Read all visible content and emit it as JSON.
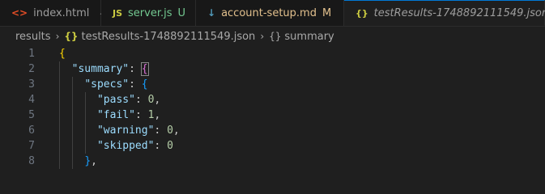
{
  "tabs": [
    {
      "icon": "html-file-icon",
      "icon_glyph": "<>",
      "icon_color": "#e44d26",
      "label": "index.html",
      "trail": "pin",
      "label_color": "#9d9d9d"
    },
    {
      "icon": "js-file-icon",
      "icon_glyph": "JS",
      "icon_color": "#cbcb41",
      "label": "server.js",
      "status": "U",
      "label_color": "#73c991"
    },
    {
      "icon": "markdown-file-icon",
      "icon_glyph": "↓",
      "icon_color": "#519aba",
      "label": "account-setup.md",
      "status": "M",
      "label_color": "#e2c08d"
    },
    {
      "icon": "json-file-icon",
      "icon_glyph": "{}",
      "icon_color": "#cbcb41",
      "label": "testResults-1748892111549.json",
      "trail": "close",
      "active": true
    }
  ],
  "breadcrumb": {
    "folder": "results",
    "file": "testResults-1748892111549.json",
    "symbol": "summary"
  },
  "editor": {
    "lines": [
      {
        "n": "1",
        "text": "{"
      },
      {
        "n": "2",
        "text": "\"summary\": {"
      },
      {
        "n": "3",
        "text": "\"specs\": {"
      },
      {
        "n": "4",
        "text": "\"pass\": 0,"
      },
      {
        "n": "5",
        "text": "\"fail\": 1,"
      },
      {
        "n": "6",
        "text": "\"warning\": 0,"
      },
      {
        "n": "7",
        "text": "\"skipped\": 0"
      },
      {
        "n": "8",
        "text": "},"
      }
    ]
  }
}
